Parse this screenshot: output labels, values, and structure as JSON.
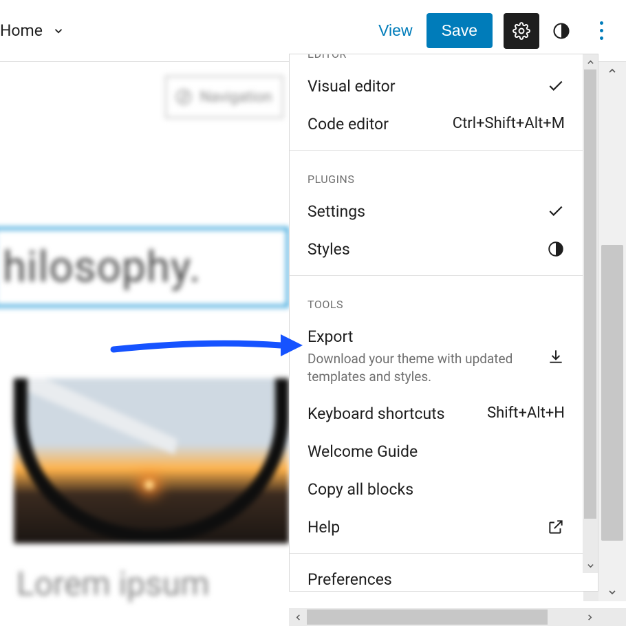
{
  "topbar": {
    "home": "Home",
    "view": "View",
    "save": "Save"
  },
  "canvas": {
    "nav_pill": "Navigation",
    "headline": "hilosophy.",
    "lorem": "Lorem ipsum"
  },
  "menu": {
    "groups": {
      "editor": "EDITOR",
      "plugins": "PLUGINS",
      "tools": "TOOLS"
    },
    "editor": {
      "visual": "Visual editor",
      "code": "Code editor",
      "code_shortcut": "Ctrl+Shift+Alt+M"
    },
    "plugins": {
      "settings": "Settings",
      "styles": "Styles"
    },
    "tools": {
      "export": "Export",
      "export_desc": "Download your theme with updated templates and styles.",
      "shortcuts": "Keyboard shortcuts",
      "shortcuts_key": "Shift+Alt+H",
      "welcome": "Welcome Guide",
      "copy": "Copy all blocks",
      "help": "Help"
    },
    "preferences": "Preferences"
  }
}
